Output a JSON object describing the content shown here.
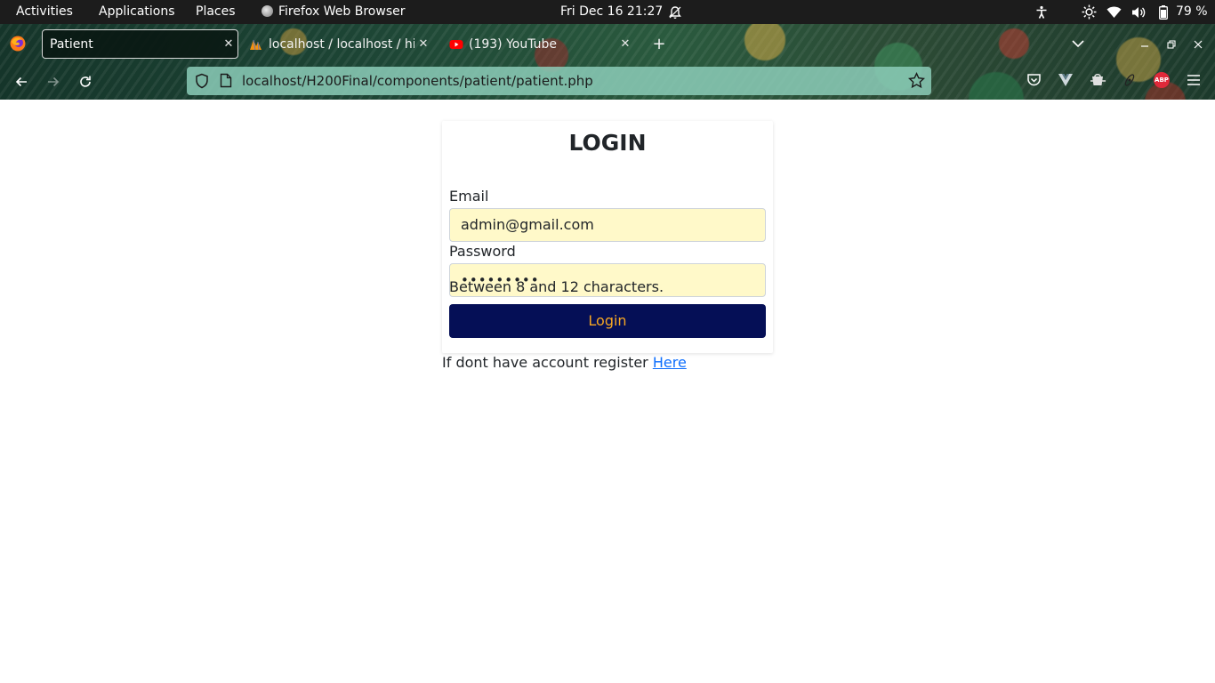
{
  "topbar": {
    "activities": "Activities",
    "applications": "Applications",
    "places": "Places",
    "app_name": "Firefox Web Browser",
    "clock": "Fri Dec 16  21:27",
    "battery": "79 %"
  },
  "browser": {
    "tabs": [
      {
        "title": "Patient",
        "active": true,
        "favicon": "firefox-icon"
      },
      {
        "title": "localhost / localhost / hit",
        "active": false,
        "favicon": "phpmyadmin-icon"
      },
      {
        "title": "(193) YouTube",
        "active": false,
        "favicon": "youtube-icon"
      }
    ],
    "url": "localhost/H200Final/components/patient/patient.php"
  },
  "login": {
    "title": "LOGIN",
    "email_label": "Email",
    "email_value": "admin@gmail.com",
    "password_label": "Password",
    "password_value": "•••••••••",
    "hint": "Between 8 and 12 characters.",
    "button": "Login",
    "register_text": "If dont have account register ",
    "register_link": "Here"
  },
  "colors": {
    "input_autofill_bg": "#fff9c9",
    "button_bg": "#050f56",
    "button_text": "#f5a623",
    "link": "#0d6efd"
  }
}
